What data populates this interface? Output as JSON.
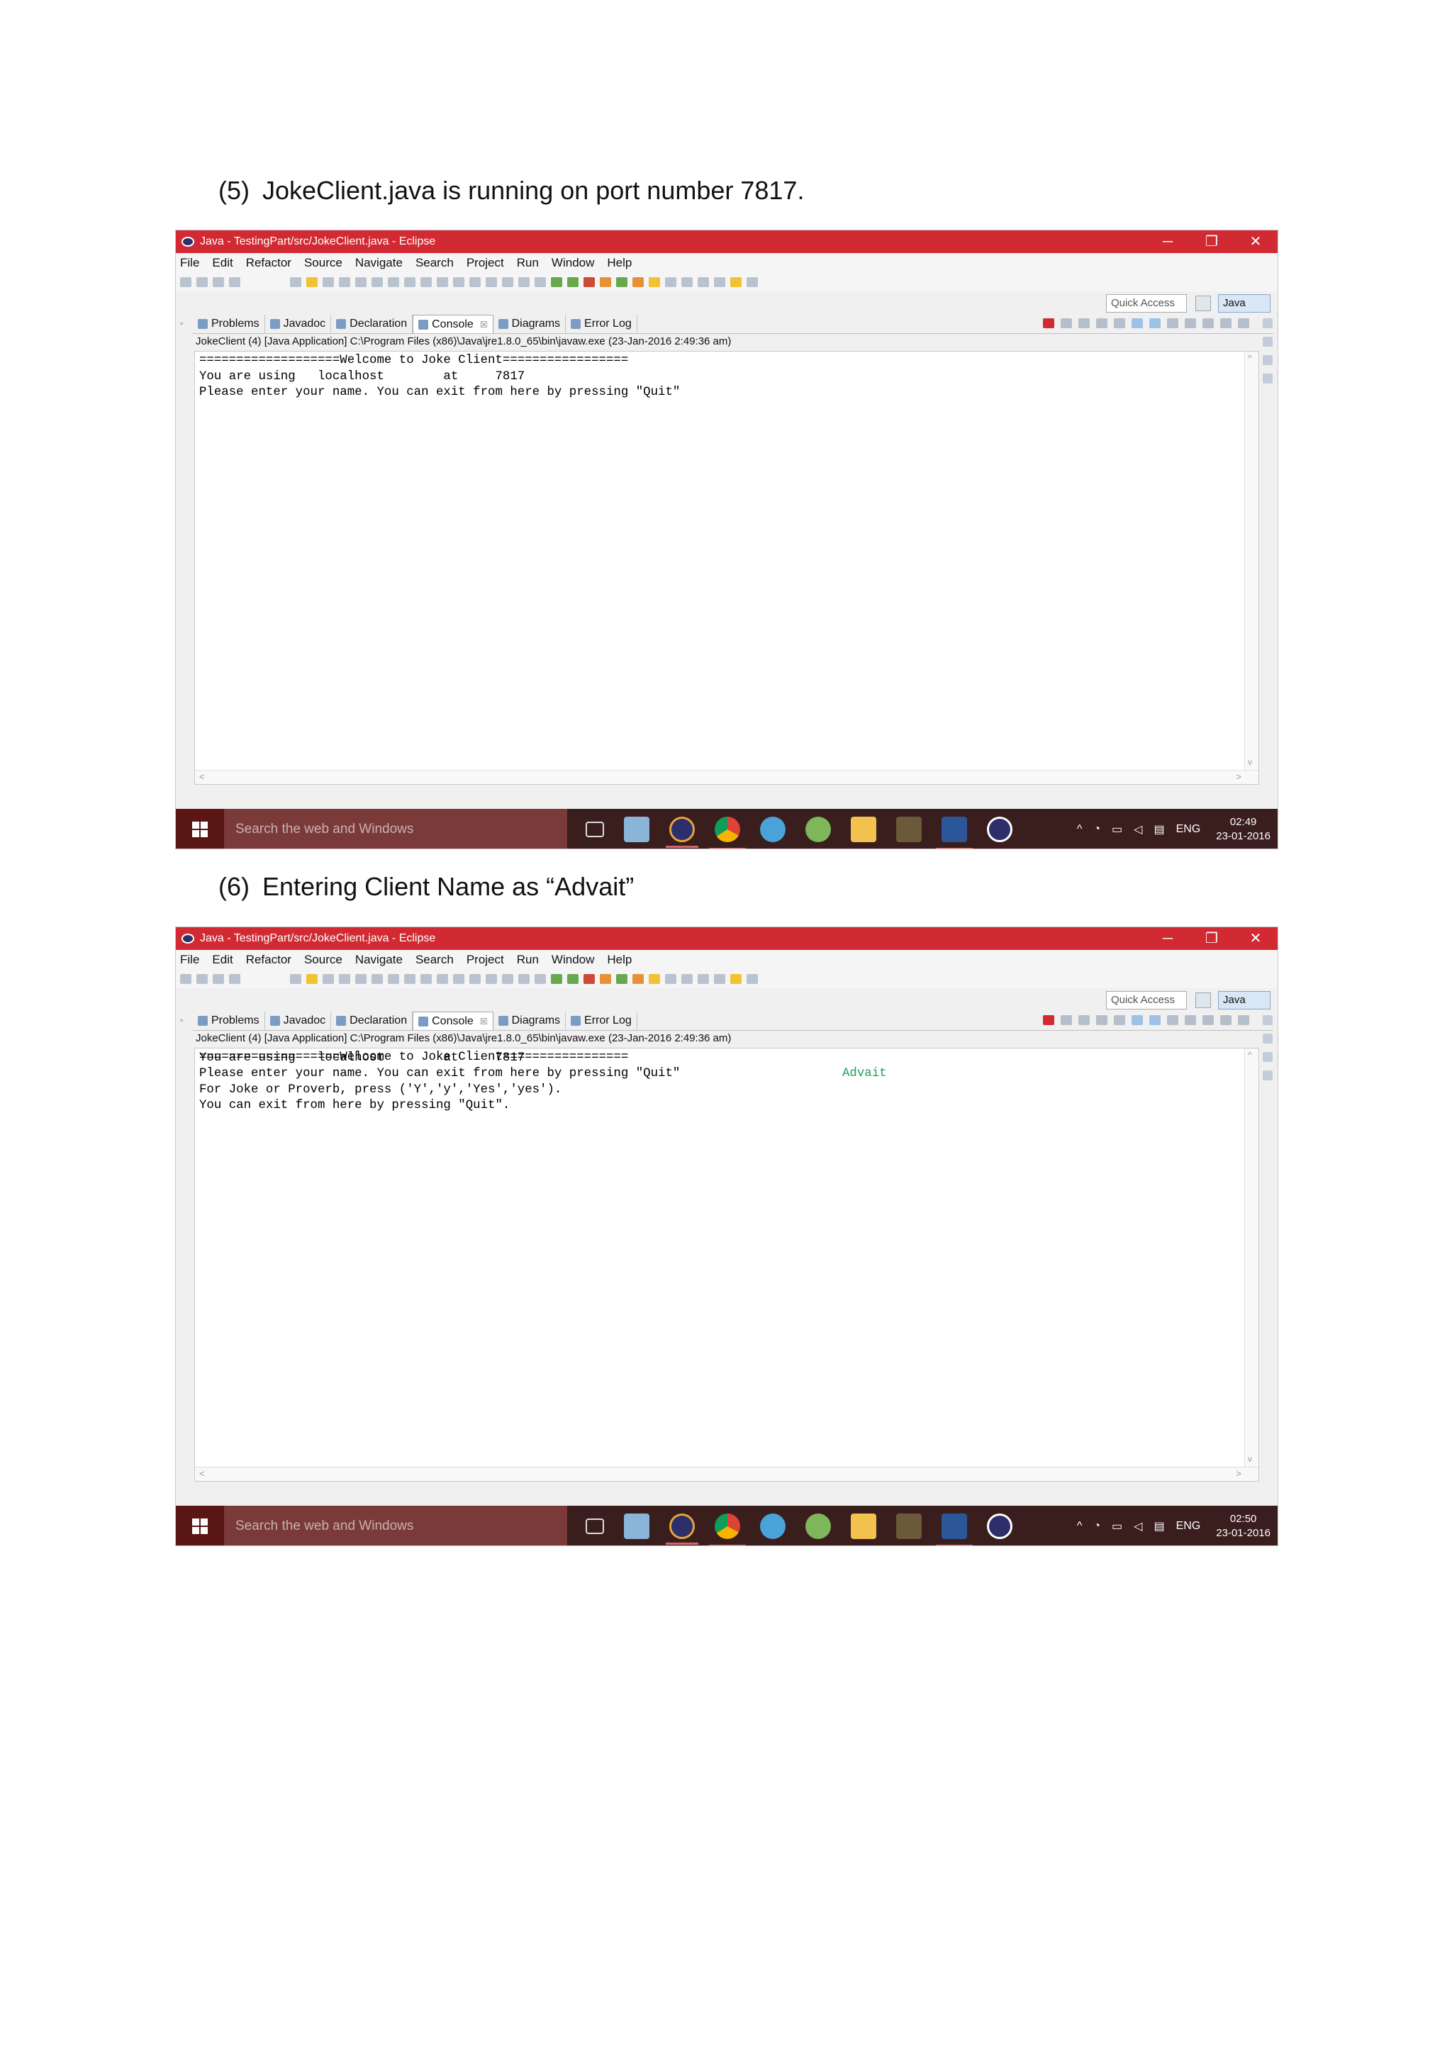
{
  "captions": [
    {
      "num": "(5)",
      "text": "JokeClient.java is running on port number 7817."
    },
    {
      "num": "(6)",
      "text": "Entering Client Name as “Advait”"
    }
  ],
  "eclipse": {
    "window_title": "Java - TestingPart/src/JokeClient.java - Eclipse",
    "window_buttons": {
      "minimize": "─",
      "restore": "❐",
      "close": "✕"
    },
    "menu": [
      "File",
      "Edit",
      "Refactor",
      "Source",
      "Navigate",
      "Search",
      "Project",
      "Run",
      "Window",
      "Help"
    ],
    "quick_access_placeholder": "Quick Access",
    "perspective_label": "Java",
    "tabs": [
      {
        "label": "Problems",
        "icon": "problems-icon"
      },
      {
        "label": "Javadoc",
        "icon": "javadoc-icon"
      },
      {
        "label": "Declaration",
        "icon": "declaration-icon"
      },
      {
        "label": "Console",
        "icon": "console-icon",
        "active": true,
        "close": "☒"
      },
      {
        "label": "Diagrams",
        "icon": "diagrams-icon"
      },
      {
        "label": "Error Log",
        "icon": "error-log-icon"
      }
    ],
    "launch_info": "JokeClient (4) [Java Application] C:\\Program Files (x86)\\Java\\jre1.8.0_65\\bin\\javaw.exe (23-Jan-2016 2:49:36 am)"
  },
  "screenshots": [
    {
      "console_lines": [
        "===================Welcome to Joke Client=================",
        "You are using   localhost        at     7817",
        "Please enter your name. You can exit from here by pressing \"Quit\""
      ],
      "input_echo": "",
      "clock_time": "02:49",
      "clock_date": "23-01-2016"
    },
    {
      "console_lines": [
        "===================Welcome to Joke Client=================",
        "You are using   localhost        at     7817",
        "Please enter your name. You can exit from here by pressing \"Quit\"",
        "For Joke or Proverb, press ('Y','y','Yes','yes').",
        "You can exit from here by pressing \"Quit\"."
      ],
      "input_echo": "Advait",
      "clock_time": "02:50",
      "clock_date": "23-01-2016"
    }
  ],
  "taskbar": {
    "search_placeholder": "Search the web and Windows",
    "language": "ENG",
    "tray_arrow": "^",
    "colors": {
      "bar": "#3a1d1d",
      "search": "#7a3a3a",
      "titlebar": "#d12a33"
    }
  }
}
